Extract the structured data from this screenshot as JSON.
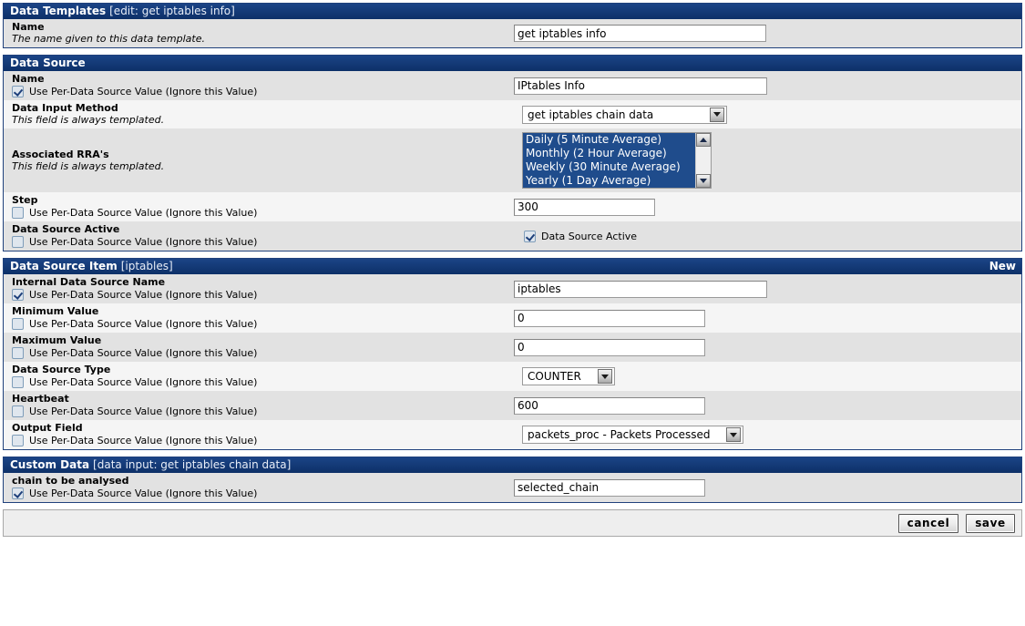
{
  "colors": {
    "header_bg": "#10366f",
    "header_border": "#20417c",
    "row_dark": "#e2e2e2",
    "row_light": "#f5f5f5",
    "select_highlight": "#1f4c8c"
  },
  "per_ds_label": "Use Per-Data Source Value (Ignore this Value)",
  "always_templated": "This field is always templated.",
  "sections": {
    "data_templates": {
      "title": "Data Templates",
      "subtitle": "[edit: get iptables info]",
      "rows": [
        {
          "label": "Name",
          "sublabel": "The name given to this data template.",
          "value": "get iptables info"
        }
      ]
    },
    "data_source": {
      "title": "Data Source",
      "subtitle": "",
      "rows": [
        {
          "label": "Name",
          "checkbox_label": "Use Per-Data Source Value (Ignore this Value)",
          "checked": true,
          "value": "IPtables Info"
        },
        {
          "label": "Data Input Method",
          "sublabel": "This field is always templated.",
          "value": "get iptables chain data"
        },
        {
          "label": "Associated RRA's",
          "sublabel": "This field is always templated.",
          "options": [
            "Daily (5 Minute Average)",
            "Monthly (2 Hour Average)",
            "Weekly (30 Minute Average)",
            "Yearly (1 Day Average)"
          ]
        },
        {
          "label": "Step",
          "checkbox_label": "Use Per-Data Source Value (Ignore this Value)",
          "checked": false,
          "value": "300"
        },
        {
          "label": "Data Source Active",
          "checkbox_label": "Use Per-Data Source Value (Ignore this Value)",
          "checked": false,
          "field_checkbox_label": "Data Source Active",
          "field_checked": true
        }
      ]
    },
    "data_source_item": {
      "title": "Data Source Item",
      "subtitle": "[iptables]",
      "right_action": "New",
      "rows": [
        {
          "label": "Internal Data Source Name",
          "checked": true,
          "value": "iptables"
        },
        {
          "label": "Minimum Value",
          "checked": false,
          "value": "0"
        },
        {
          "label": "Maximum Value",
          "checked": false,
          "value": "0"
        },
        {
          "label": "Data Source Type",
          "checked": false,
          "value": "COUNTER"
        },
        {
          "label": "Heartbeat",
          "checked": false,
          "value": "600"
        },
        {
          "label": "Output Field",
          "checked": false,
          "value": "packets_proc - Packets Processed"
        }
      ]
    },
    "custom_data": {
      "title": "Custom Data",
      "subtitle": "[data input: get iptables chain data]",
      "rows": [
        {
          "label": "chain to be analysed",
          "checked": true,
          "value": "selected_chain"
        }
      ]
    }
  },
  "actions": {
    "cancel_label": "cancel",
    "save_label": "save"
  }
}
